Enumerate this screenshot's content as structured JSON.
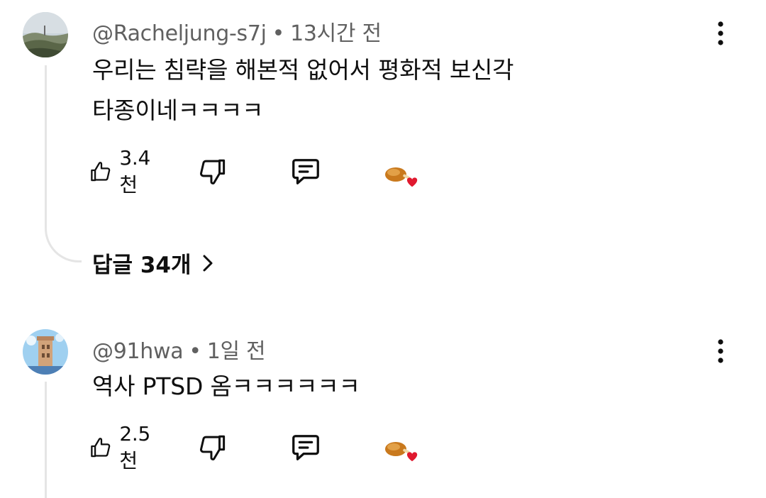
{
  "comments": [
    {
      "author": "@Racheljung-s7j",
      "separator": "•",
      "time": "13시간 전",
      "lines": [
        "우리는 침략을 해본적 없어서 평화적 보신각",
        "타종이네ㅋㅋㅋㅋ"
      ],
      "likes": "3.4천",
      "replies_label": "답글 34개",
      "avatar_icon": "landscape-avatar",
      "heart_color": "#e0192f"
    },
    {
      "author": "@91hwa",
      "separator": "•",
      "time": "1일 전",
      "lines": [
        "역사 PTSD 옴ㅋㅋㅋㅋㅋㅋ"
      ],
      "likes": "2.5천",
      "avatar_icon": "tower-avatar",
      "heart_color": "#e0192f"
    }
  ]
}
